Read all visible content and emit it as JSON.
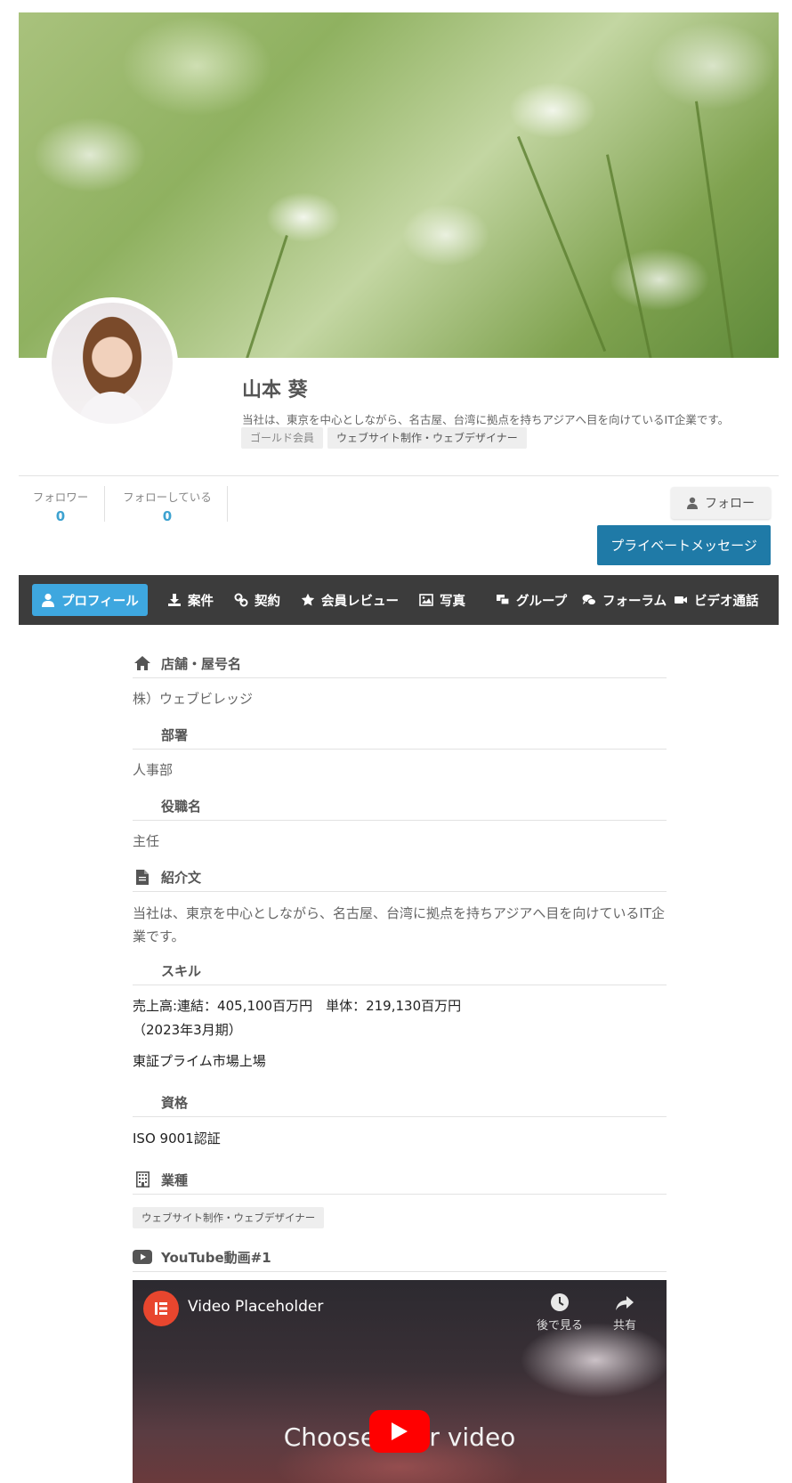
{
  "profile": {
    "name": "山本 葵",
    "bio": "当社は、東京を中心としながら、名古屋、台湾に拠点を持ちアジアへ目を向けているIT企業です。",
    "tags": [
      "ゴールド会員",
      "ウェブサイト制作・ウェブデザイナー"
    ]
  },
  "stats": {
    "followers_label": "フォロワー",
    "followers_count": "0",
    "following_label": "フォローしている",
    "following_count": "0"
  },
  "actions": {
    "follow_label": "フォロー",
    "private_message_label": "プライベートメッセージ"
  },
  "nav": {
    "items": [
      {
        "label": "プロフィール",
        "icon": "user-icon",
        "active": true
      },
      {
        "label": "案件",
        "icon": "download-icon"
      },
      {
        "label": "契約",
        "icon": "link-icon"
      },
      {
        "label": "会員レビュー",
        "icon": "star-icon"
      },
      {
        "label": "写真",
        "icon": "image-icon"
      },
      {
        "label": "グループ",
        "icon": "group-icon"
      },
      {
        "label": "フォーラム",
        "icon": "comments-icon"
      },
      {
        "label": "ビデオ通話",
        "icon": "video-camera-icon"
      }
    ]
  },
  "details": {
    "shop_name_label": "店舗・屋号名",
    "shop_name_value": "株）ウェブビレッジ",
    "department_label": "部署",
    "department_value": "人事部",
    "position_label": "役職名",
    "position_value": "主任",
    "intro_label": "紹介文",
    "intro_value": "当社は、東京を中心としながら、名古屋、台湾に拠点を持ちアジアへ目を向けているIT企業です。",
    "skill_label": "スキル",
    "skill_line1": "売上高:連結：405,100百万円　単体：219,130百万円",
    "skill_line2": "（2023年3月期）",
    "skill_line3": "東証プライム市場上場",
    "qualification_label": "資格",
    "qualification_value": "ISO 9001認証",
    "industry_label": "業種",
    "industry_tag": "ウェブサイト制作・ウェブデザイナー",
    "youtube_label": "YouTube動画#1"
  },
  "video": {
    "title": "Video Placeholder",
    "watch_later": "後で見る",
    "share": "共有",
    "center_text": "Choose your video"
  },
  "colors": {
    "accent": "#3ea7df",
    "primary_button": "#1f7aa7",
    "navbar": "#3c3c3c",
    "count": "#3da2d0"
  }
}
